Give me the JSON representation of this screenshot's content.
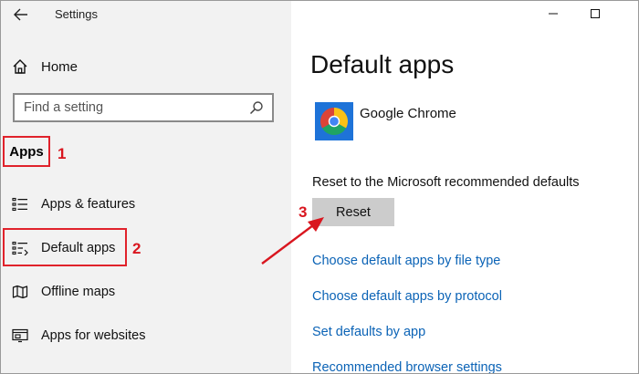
{
  "window": {
    "title": "Settings",
    "back_icon": "back-arrow-icon",
    "minimize_icon": "minimize-icon",
    "maximize_icon": "maximize-icon"
  },
  "sidebar": {
    "home": {
      "label": "Home",
      "icon": "home-icon"
    },
    "search": {
      "placeholder": "Find a setting",
      "icon": "search-icon"
    },
    "section_heading": "Apps",
    "items": [
      {
        "label": "Apps & features",
        "icon": "apps-features-icon"
      },
      {
        "label": "Default apps",
        "icon": "default-apps-icon",
        "selected": true
      },
      {
        "label": "Offline maps",
        "icon": "offline-maps-icon"
      },
      {
        "label": "Apps for websites",
        "icon": "apps-for-websites-icon"
      }
    ]
  },
  "main": {
    "title": "Default apps",
    "app": {
      "name": "Google Chrome",
      "icon": "chrome-icon"
    },
    "reset_caption": "Reset to the Microsoft recommended defaults",
    "reset_button": "Reset",
    "links": [
      "Choose default apps by file type",
      "Choose default apps by protocol",
      "Set defaults by app",
      "Recommended browser settings"
    ]
  },
  "annotations": {
    "step1": "1",
    "step2": "2",
    "step3": "3",
    "highlight_color": "#e0222b"
  },
  "colors": {
    "sidebar_bg": "#f2f2f2",
    "link": "#0b63b6",
    "button_bg": "#cccccc"
  }
}
